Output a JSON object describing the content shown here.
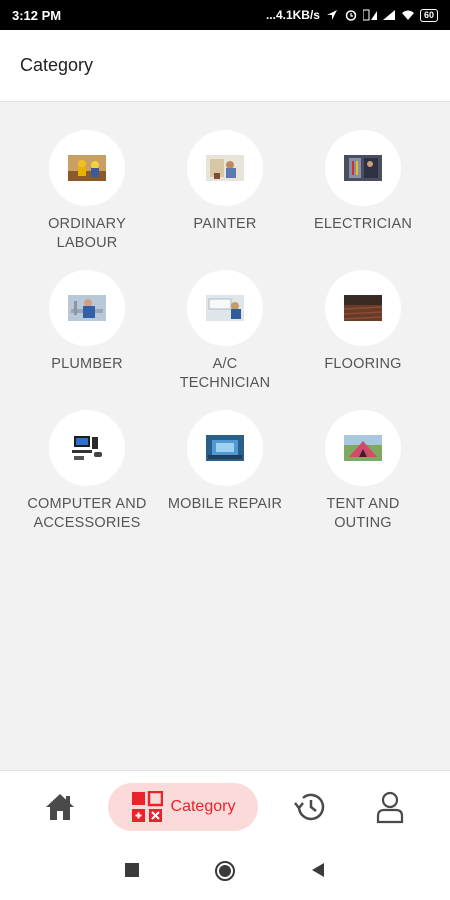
{
  "status_bar": {
    "time": "3:12 PM",
    "speed": "...4.1KB/s",
    "battery": "60"
  },
  "header": {
    "title": "Category"
  },
  "categories": [
    {
      "label": "ORDINARY\nLABOUR",
      "icon": "worker-photo"
    },
    {
      "label": "PAINTER",
      "icon": "painter-photo"
    },
    {
      "label": "ELECTRICIAN",
      "icon": "electrician-photo"
    },
    {
      "label": "PLUMBER",
      "icon": "plumber-photo"
    },
    {
      "label": "A/C\nTECHNICIAN",
      "icon": "ac-technician-photo"
    },
    {
      "label": "FLOORING",
      "icon": "flooring-photo"
    },
    {
      "label": "COMPUTER AND\nACCESSORIES",
      "icon": "computer-photo"
    },
    {
      "label": "MOBILE REPAIR",
      "icon": "mobile-repair-photo"
    },
    {
      "label": "TENT AND\nOUTING",
      "icon": "tent-photo"
    }
  ],
  "bottom_nav": {
    "active_label": "Category",
    "accent": "#e8232a",
    "pill_bg": "#fbdada"
  }
}
